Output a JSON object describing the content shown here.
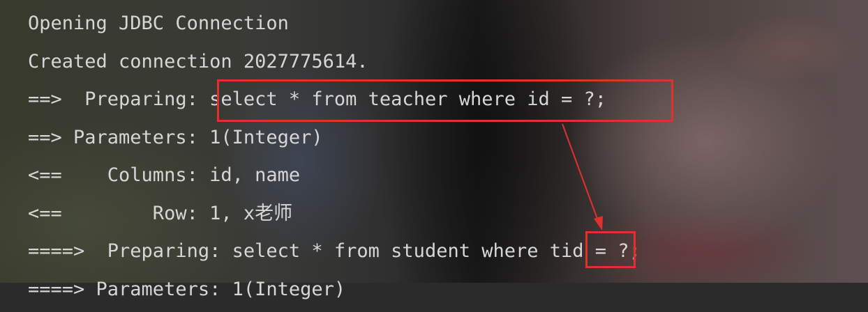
{
  "console": {
    "lines": [
      {
        "text": "Opening JDBC Connection"
      },
      {
        "text": "Created connection 2027775614."
      },
      {
        "prefix": "==>  Preparing: ",
        "sql": "select * from teacher where id = ?;"
      },
      {
        "text": "==> Parameters: 1(Integer)"
      },
      {
        "text": "<==    Columns: id, name"
      },
      {
        "text": "<==        Row: 1, x老师"
      },
      {
        "prefix": "====>  Preparing: select * from student where ",
        "hl": "tid",
        "suffix": " = ?;"
      },
      {
        "text": "====> Parameters: 1(Integer)"
      }
    ]
  },
  "annotations": {
    "highlight_color": "#e0312f",
    "arrow_from": "teacher-sql-highlight",
    "arrow_to": "tid-highlight"
  }
}
